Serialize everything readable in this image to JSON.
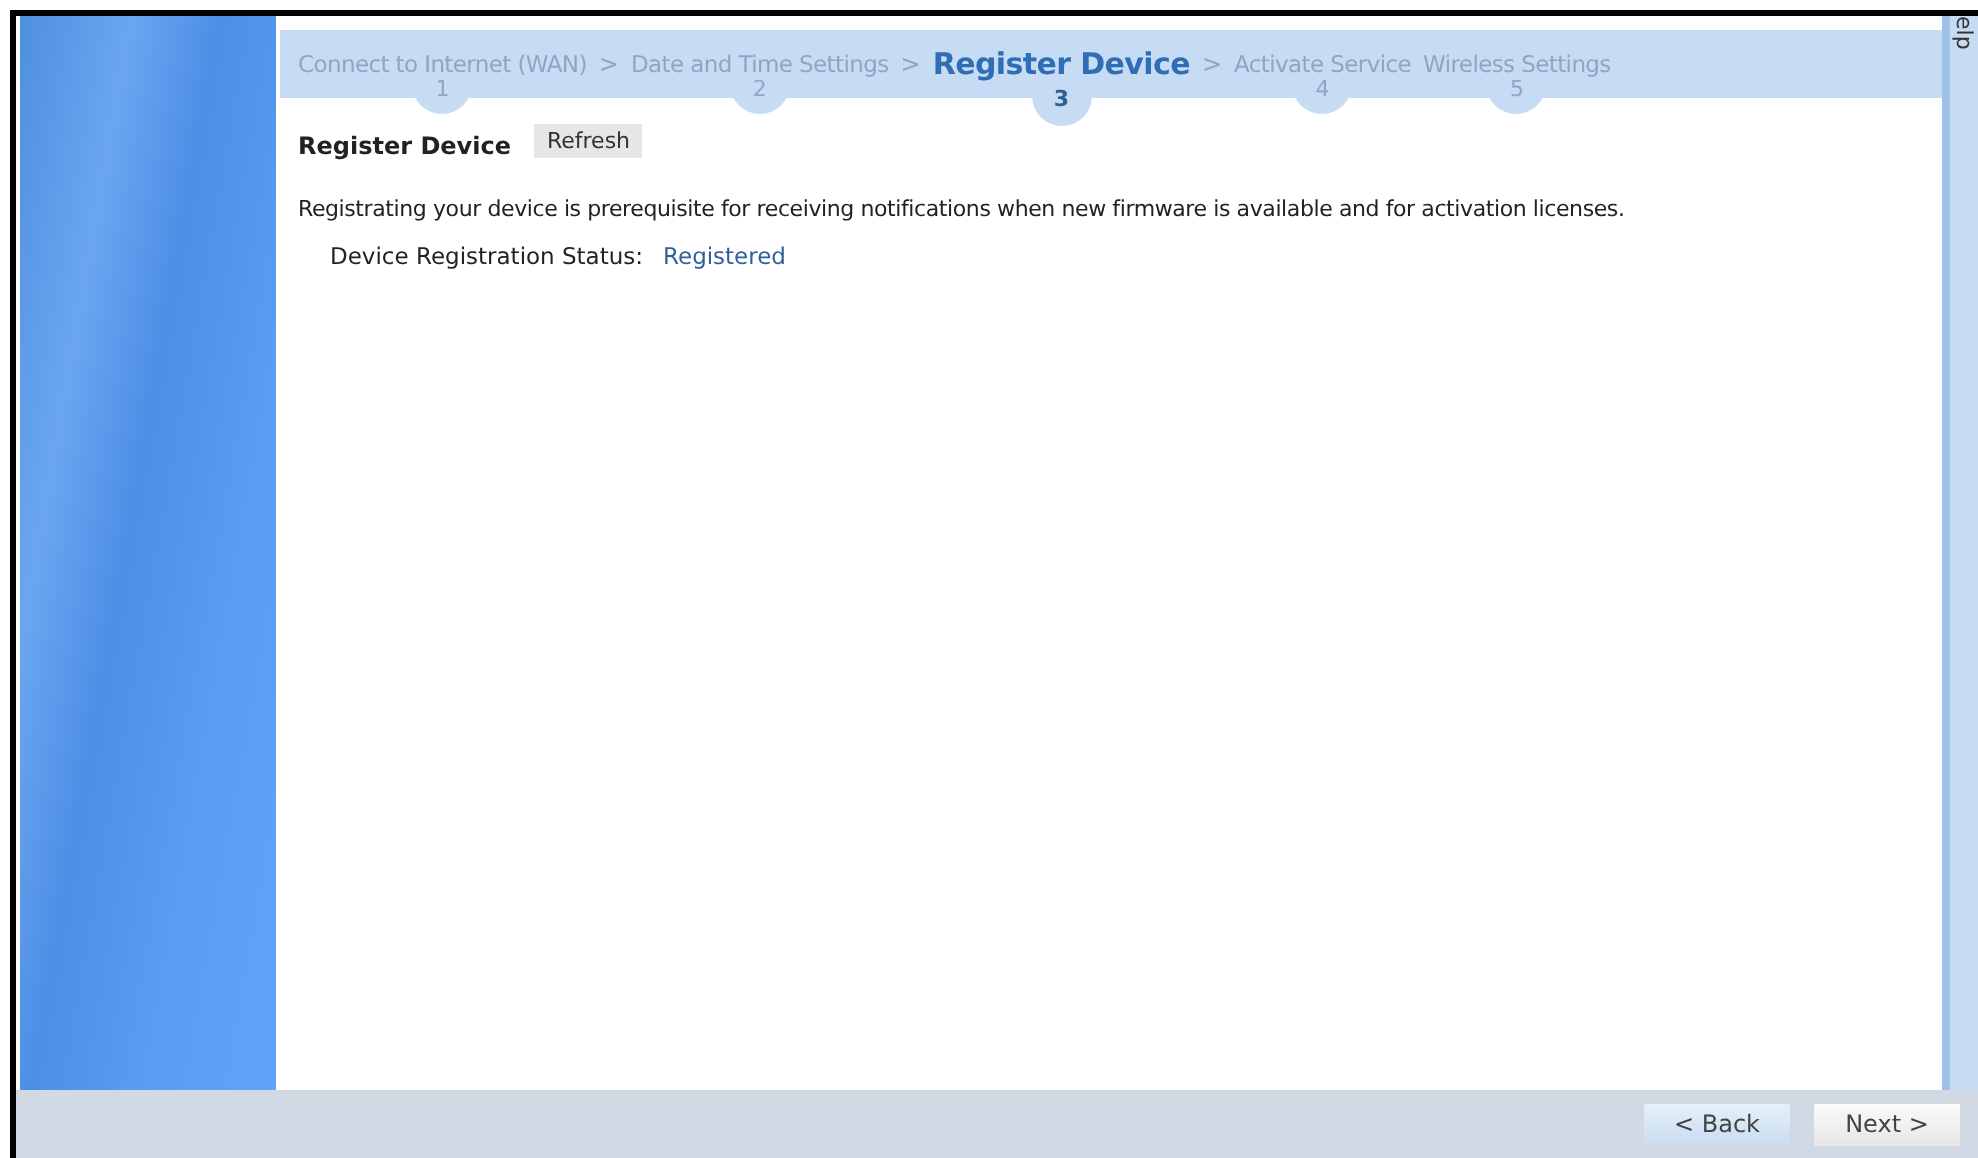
{
  "steps": [
    {
      "label": "Connect to Internet (WAN)",
      "number": "1",
      "selected": false,
      "separator": ">"
    },
    {
      "label": "Date and Time Settings",
      "number": "2",
      "selected": false,
      "separator": ">"
    },
    {
      "label": "Register Device",
      "number": "3",
      "selected": true,
      "separator": ">"
    },
    {
      "label": "Activate Service",
      "number": "4",
      "selected": false
    },
    {
      "label": "Wireless Settings",
      "number": "5",
      "selected": false
    }
  ],
  "help_tab": {
    "label": "elp"
  },
  "section": {
    "title": "Register Device",
    "refresh_button": "Refresh"
  },
  "description": "Registrating your device is prerequisite for receiving notifications when new firmware is available and for activation licenses.",
  "status": {
    "label": "Device Registration Status:",
    "value": "Registered"
  },
  "buttons": [
    {
      "label": "< Back",
      "kind": "back"
    },
    {
      "label": "Next >",
      "kind": "next"
    }
  ]
}
